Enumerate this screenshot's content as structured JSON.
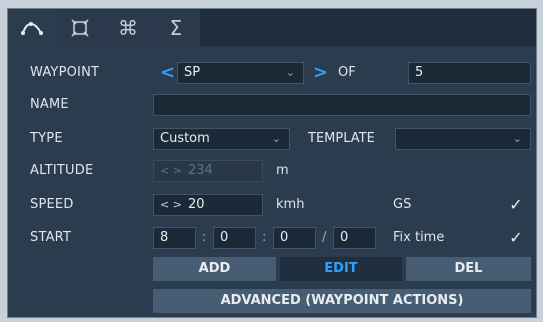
{
  "tabs": [
    {
      "icon": "waypoint-path-icon",
      "glyph": "⌒",
      "active": true
    },
    {
      "icon": "target-frame-icon",
      "glyph": "⌘",
      "active": false
    },
    {
      "icon": "command-icon",
      "glyph": "⌘",
      "active": false
    },
    {
      "icon": "sigma-icon",
      "glyph": "Σ",
      "active": false
    }
  ],
  "labels": {
    "waypoint": "WAYPOINT",
    "name": "NAME",
    "type": "TYPE",
    "altitude": "ALTITUDE",
    "speed": "SPEED",
    "start": "START",
    "of": "OF",
    "template": "TEMPLATE",
    "alt_unit": "m",
    "speed_unit": "kmh",
    "gs": "GS",
    "fix_time": "Fix time"
  },
  "waypoint": {
    "selected": "SP",
    "total": "5",
    "prev_glyph": "<",
    "next_glyph": ">"
  },
  "name_value": "",
  "type_value": "Custom",
  "template_value": "",
  "altitude": {
    "arrows": "< >",
    "value": "234"
  },
  "speed": {
    "arrows": "< >",
    "value": "20"
  },
  "start": {
    "h": "8",
    "m": "0",
    "s": "0",
    "frac": "0",
    "sep1": ":",
    "sep2": ":",
    "sep3": "/"
  },
  "checks": {
    "gs": "✓",
    "fix_time": "✓"
  },
  "buttons": {
    "add": "ADD",
    "edit": "EDIT",
    "del": "DEL",
    "advanced": "ADVANCED (WAYPOINT ACTIONS)"
  },
  "colors": {
    "accent": "#2ea0ff",
    "panel": "#2b3c4f",
    "button": "#475d74"
  }
}
